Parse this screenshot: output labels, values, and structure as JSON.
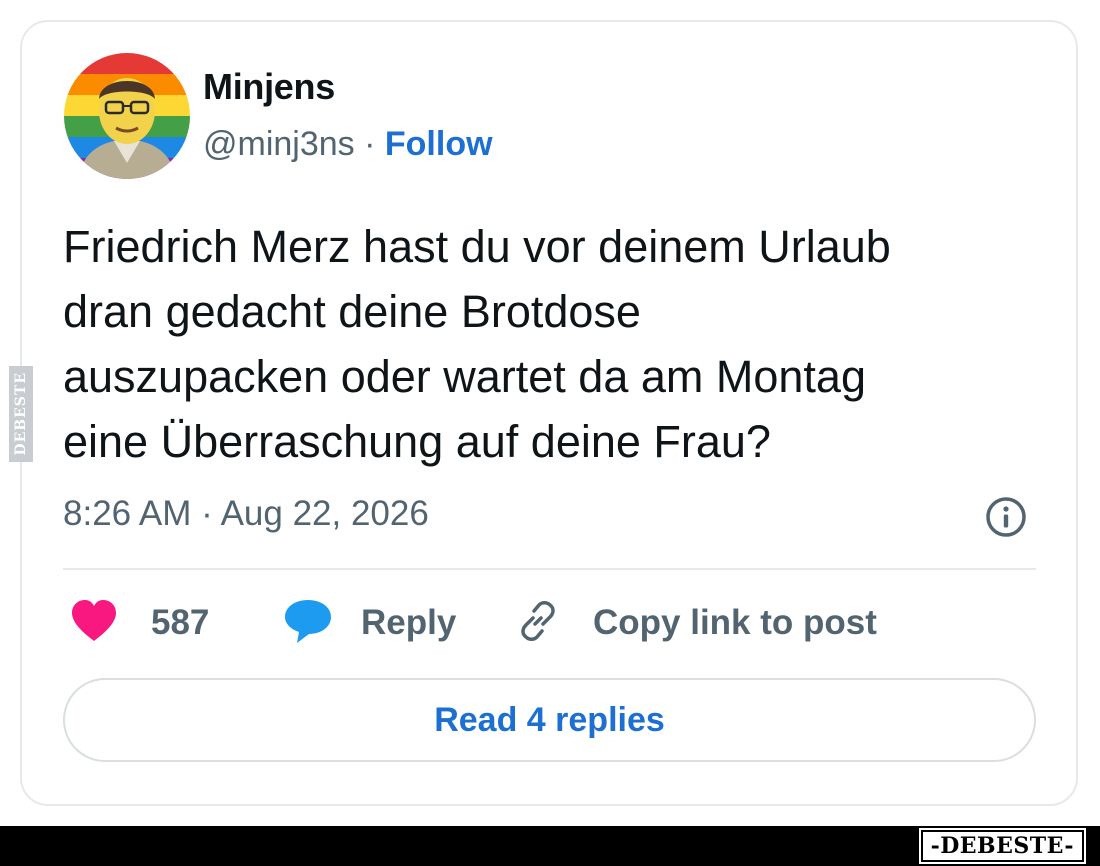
{
  "author": {
    "display_name": "Minjens",
    "handle": "@minj3ns",
    "separator": " · ",
    "follow_label": "Follow"
  },
  "tweet": {
    "text": "Friedrich Merz hast du vor deinem Urlaub\ndran gedacht deine Brotdose\nauszupacken oder wartet da am Montag\neine Überraschung auf deine Frau?",
    "timestamp": "8:26 AM · Aug 22, 2026"
  },
  "actions": {
    "like_count": "587",
    "reply_label": "Reply",
    "copy_link_label": "Copy link to post",
    "read_replies_label": "Read 4 replies"
  },
  "icons": {
    "like": "heart-icon",
    "reply": "speech-bubble-icon",
    "copy_link": "link-icon",
    "info": "info-icon"
  },
  "colors": {
    "like": "#f91880",
    "reply": "#1d9bf0",
    "link": "#1d6fd1",
    "muted": "#536471"
  },
  "watermark": {
    "side_text": "DEBESTE",
    "bottom_text": "-DEBESTE-"
  }
}
